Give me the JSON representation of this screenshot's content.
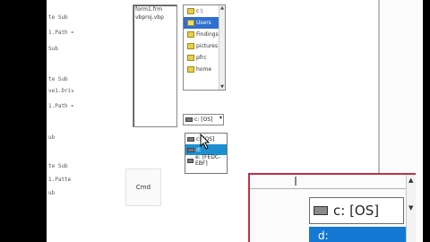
{
  "code_lines": [
    "te Sub",
    "1.Path =",
    "Sub",
    "te Sub",
    "ve1.Driv",
    "1.Path =",
    "ub",
    "te Sub",
    "1.Patte",
    "ub"
  ],
  "file_list": {
    "items": [
      "form1.frm",
      "vbproj.vbp"
    ]
  },
  "dir_list": {
    "items": [
      {
        "label": "c:\\",
        "selected": false
      },
      {
        "label": "Users",
        "selected": true
      },
      {
        "label": "Findings",
        "selected": false
      },
      {
        "label": "pictures",
        "selected": false
      },
      {
        "label": "pfrc",
        "selected": false
      },
      {
        "label": "home",
        "selected": false
      }
    ]
  },
  "drive_combo": {
    "value": "c: [OS]"
  },
  "drive_options": [
    {
      "label": "c: [OS]",
      "selected": false
    },
    {
      "label": "d:",
      "selected": true
    },
    {
      "label": "e: [FEDC-EBF]",
      "selected": false
    }
  ],
  "command_button": {
    "label": "Cmd"
  },
  "zoom": {
    "combo_value": "c: [OS]",
    "selected_option": "d:"
  },
  "colors": {
    "selection": "#2f6fd0",
    "drop_selection": "#1d8fd0",
    "zoom_border": "#c0304a"
  }
}
